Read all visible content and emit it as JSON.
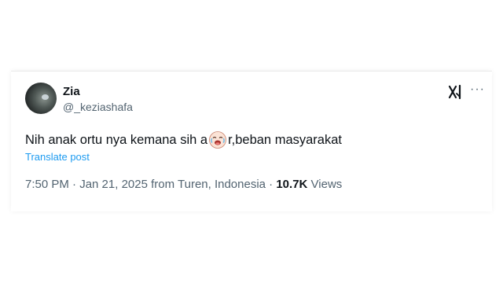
{
  "tweet": {
    "display_name": "Zia",
    "handle": "@_keziashafa",
    "text_before": "Nih anak ortu nya kemana sih a",
    "text_after": "r,beban masyarakat",
    "emoji_icon": "crying-laughing-face-emoji",
    "translate_label": "Translate post",
    "timestamp": "7:50 PM · Jan 21, 2025 from Turen, Indonesia · ",
    "views_count": "10.7K",
    "views_label": " Views",
    "more_label": "···",
    "colors": {
      "text": "#0f1419",
      "secondary": "#536471",
      "link": "#1d9bf0"
    }
  }
}
